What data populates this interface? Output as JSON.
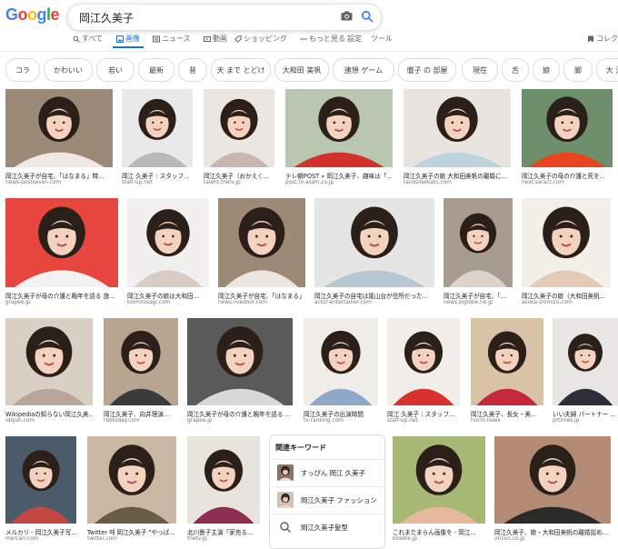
{
  "header": {
    "logo_letters": [
      {
        "ch": "G",
        "color": "#4285F4"
      },
      {
        "ch": "o",
        "color": "#EA4335"
      },
      {
        "ch": "o",
        "color": "#FBBC05"
      },
      {
        "ch": "g",
        "color": "#4285F4"
      },
      {
        "ch": "l",
        "color": "#34A853"
      },
      {
        "ch": "e",
        "color": "#EA4335"
      }
    ],
    "query": "岡江久美子",
    "tabs": [
      "すべて",
      "画像",
      "ニュース",
      "動画",
      "ショッピング",
      "もっと見る",
      "設定",
      "ツール"
    ],
    "active_tab": "画像",
    "collection_label": "コレク"
  },
  "chips": [
    "コラ",
    "かわいい",
    "若い",
    "最新",
    "昔",
    "天 まで とどけ",
    "大和田 美帆",
    "連想 ゲーム",
    "徹子 の 部屋",
    "現在",
    "舌",
    "娘",
    "脚",
    "大 江戸"
  ],
  "results": [
    {
      "caption": "岡江久美子が自宅、「はなまる」時...",
      "source": "news-postseven.com",
      "bg": "#9b8a78",
      "fg": "#f0e8e2"
    },
    {
      "caption": "岡江 久美子｜スタッフ...",
      "source": "staff-up.net",
      "bg": "#e9e9e9",
      "fg": "#b9b9b9"
    },
    {
      "caption": "岡江久美子（おかえく...",
      "source": "talent.thetv.jp",
      "bg": "#ece6e2",
      "fg": "#c9b6ae"
    },
    {
      "caption": "テレ朝POST » 岡江久美子、趣味は「...",
      "source": "post.tv-asahi.co.jp",
      "bg": "#b9c7b0",
      "fg": "#d2322a"
    },
    {
      "caption": "岡江久美子の娘 大和田美帆の離婚に...",
      "source": "tanosiisekatu.com",
      "bg": "#e9e4df",
      "fg": "#bcd3dc"
    },
    {
      "caption": "岡江久美子の母の介護と死を...",
      "source": "next.saract.com",
      "bg": "#6e8f6b",
      "fg": "#e8441f"
    },
    {
      "caption": "岡江久美子が母の介護と晩年を語る 旅...",
      "source": "grapee.jp",
      "bg": "#e7463d",
      "fg": "#f2f2f2"
    },
    {
      "caption": "岡江久美子の娘は大和田...",
      "source": "koimousagi.com",
      "bg": "#f1f0ee",
      "fg": "#d8ccc4"
    },
    {
      "caption": "岡江久美子が自宅、「はなまる」降...",
      "source": "news.livedoor.com",
      "bg": "#9c8a76",
      "fg": "#ece6e2"
    },
    {
      "caption": "岡江久美子の自宅は尾山台が住所だった...",
      "source": "actor-entertainer.com",
      "bg": "#e5e5e5",
      "fg": "#b8c8d2"
    },
    {
      "caption": "岡江久美子が自宅、「...",
      "source": "news.biglobe.ne.jp",
      "bg": "#a79c8f",
      "fg": "#dcd4cc"
    },
    {
      "caption": "岡江久美子の娘（大和田美帆...",
      "source": "asuka-shimizu.com",
      "bg": "#f3efe9",
      "fg": "#e3cbb8"
    },
    {
      "caption": "Wikipediaの知らない岡江久美...",
      "source": "idejun.com",
      "bg": "#d9cfc4",
      "fg": "#b8a69a"
    },
    {
      "caption": "岡江久美子、向井理演...",
      "source": "rbbtoday.com",
      "bg": "#b7a58f",
      "fg": "#3a3a3a"
    },
    {
      "caption": "岡江久美子が母の介護と晩年を語る ...",
      "source": "grapee.jp",
      "bg": "#5a5a5a",
      "fg": "#d8d8d8"
    },
    {
      "caption": "岡江久美子の出演時間",
      "source": "tv-ranking.com",
      "bg": "#f0ece8",
      "fg": "#8fa7c8"
    },
    {
      "caption": "岡江 久美子｜スタッフ...",
      "source": "staff-up.net",
      "bg": "#f1eeea",
      "fg": "#d9322d"
    },
    {
      "caption": "岡江久美子、長女・美...",
      "source": "hochi.news",
      "bg": "#d8c3a6",
      "fg": "#c5283d"
    },
    {
      "caption": "いい夫婦 パートナー ...",
      "source": "prtimes.jp",
      "bg": "#e8e6e4",
      "fg": "#2c2f3a"
    },
    {
      "caption": "メルカリ - 岡江久美子写...",
      "source": "mercari.com",
      "bg": "#4b5b6a",
      "fg": "#c4483f"
    },
    {
      "caption": "Twitter 때 岡江久美子 \"やっぱ...",
      "source": "twitter.com",
      "bg": "#c9b9a2",
      "fg": "#6a5a48"
    },
    {
      "caption": "北川景子主演「家売る...",
      "source": "thetv.jp",
      "bg": "#e9e3de",
      "fg": "#8e2d52"
    },
    {
      "caption": "これまたまらん画像を - 岡江...",
      "source": "bokete.jp",
      "bg": "#a7b874",
      "fg": "#e6b99a"
    },
    {
      "caption": "岡江久美子、娘・大和田美帆の離婚認め...",
      "source": "oricon.co.jp",
      "bg": "#b38a74",
      "fg": "#2a2a2a"
    }
  ],
  "related": {
    "title": "関連キーワード",
    "items": [
      {
        "label": "すっぴん 岡江 久美子",
        "thumb_bg": "#8c7466"
      },
      {
        "label": "岡江久美子 ファッション",
        "thumb_bg": "#d0c2b4"
      },
      {
        "label": "岡江久美子髪型",
        "thumb_bg": "#ffffff"
      }
    ]
  }
}
